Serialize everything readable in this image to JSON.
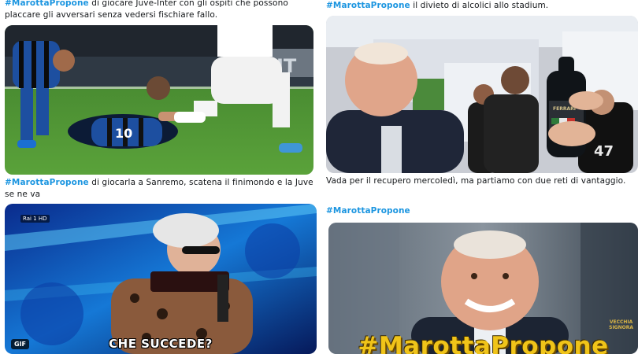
{
  "tweets": [
    {
      "hashtag": "#MarottaPropone",
      "text": " di giocare Juve-Inter con gli ospiti che possono placcare gli avversari senza vedersi fischiare fallo."
    },
    {
      "hashtag": "#MarottaPropone",
      "text": " il divieto di alcolici allo stadium."
    },
    {
      "hashtag": "#MarottaPropone",
      "text": " di giocarla a Sanremo, scatena il finimondo e la Juve se ne va"
    },
    {
      "hashtag": "",
      "text": "Vada per il recupero mercoledì, ma partiamo con due reti di vantaggio."
    },
    {
      "hashtag": "#MarottaPropone",
      "text": ""
    }
  ],
  "media": {
    "football": {
      "shirt_number": "10"
    },
    "celebration": {
      "shirt_number": "47",
      "bottle_label": "FERRARI"
    },
    "sanremo": {
      "channel": "Rai 1 HD",
      "gif_badge": "GIF",
      "caption": "CHE SUCCEDE?"
    },
    "marotta": {
      "big_hashtag": "#MarottaPropone",
      "logo_line1": "VECCHIA",
      "logo_line2": "SIGNORA"
    }
  },
  "colors": {
    "hashtag": "#1b95e0",
    "inter_blue": "#1d4fa0",
    "gold_text": "#f0c419"
  }
}
